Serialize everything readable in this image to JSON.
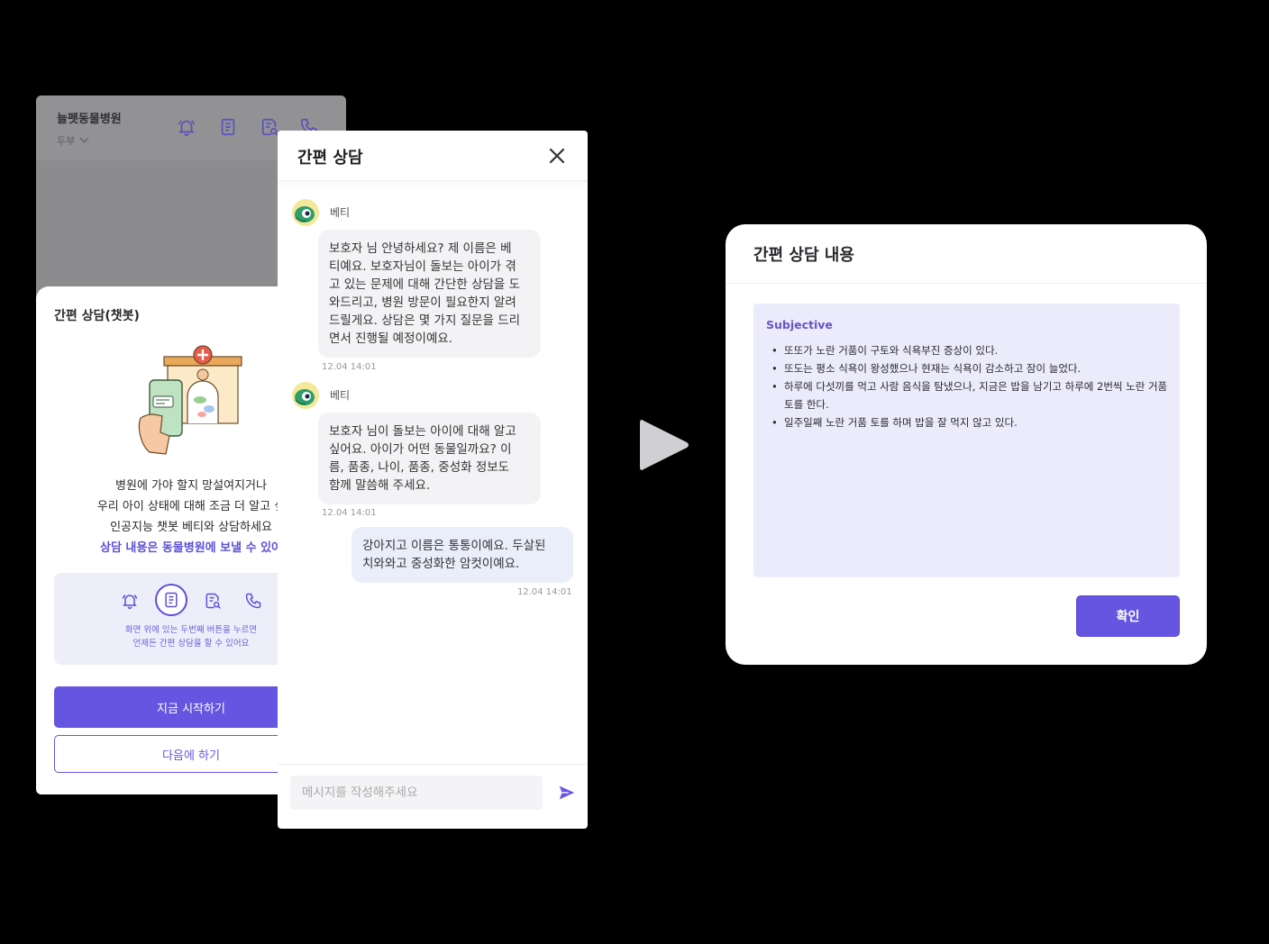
{
  "app": {
    "hospital_name": "늘펫동물병원",
    "location": "두부"
  },
  "bottom_sheet": {
    "title": "간편 상담(챗봇)",
    "description_lines": [
      "병원에 가야 할지 망설여지거나",
      "우리 아이 상태에 대해 조금 더 알고 싶",
      "인공지능 챗봇 베티와 상담하세요"
    ],
    "description_accent": "상담 내용은 동물병원에 보낼 수 있어",
    "hint_lines": [
      "화면 위에 있는 두번째 버튼을 누르면",
      "언제든 간편 상담을 할 수 있어요"
    ],
    "start_button": "지금 시작하기",
    "later_button": "다음에 하기"
  },
  "chat": {
    "title": "간편 상담",
    "bot_name": "베티",
    "messages": [
      {
        "from": "bot",
        "lines": [
          "보호자 님 안녕하세요? 제 이름은 베",
          "티예요. 보호자님이 돌보는 아이가 겪",
          "고 있는 문제에 대해 간단한 상담을 도",
          "와드리고, 병원 방문이 필요한지 알려",
          "드릴게요. 상담은 몇 가지 질문을 드리",
          "면서 진행될 예정이예요."
        ],
        "time": "12.04 14:01"
      },
      {
        "from": "bot",
        "lines": [
          "보호자 님이 돌보는 아이에 대해 알고",
          "싶어요. 아이가 어떤 동물일까요? 이",
          "름, 품종, 나이, 품종, 중성화 정보도",
          "함께 말씀해 주세요."
        ],
        "time": "12.04 14:01"
      },
      {
        "from": "user",
        "lines": [
          "강아지고 이름은 통통이예요. 두살된",
          "치와와고 중성화한 암컷이예요."
        ],
        "time": "12.04 14:01"
      }
    ],
    "input_placeholder": "메시지를 작성해주세요"
  },
  "summary": {
    "title": "간편 상담 내용",
    "section_label": "Subjective",
    "items": [
      "또또가 노란 거품이 구토와 식욕부진 증상이 있다.",
      "또도는 평소 식욕이 왕성했으나 현재는 식욕이 감소하고 잠이 늘었다.",
      "하루에 다섯끼를 먹고 사람 음식을 탐냈으나, 지금은 밥을 남기고 하루에 2번씩 노란 거품 토를 한다.",
      "일주일째 노란 거품 토를 하며 밥을 잘 먹지 않고 있다."
    ],
    "confirm_button": "확인"
  },
  "colors": {
    "accent": "#6655e0",
    "hint_bg": "#eeeefb",
    "summary_box_bg": "#ecebfb"
  },
  "icons": [
    "bell-icon",
    "document-icon",
    "search-document-icon",
    "phone-icon",
    "close-icon",
    "send-icon",
    "play-arrow-icon"
  ]
}
